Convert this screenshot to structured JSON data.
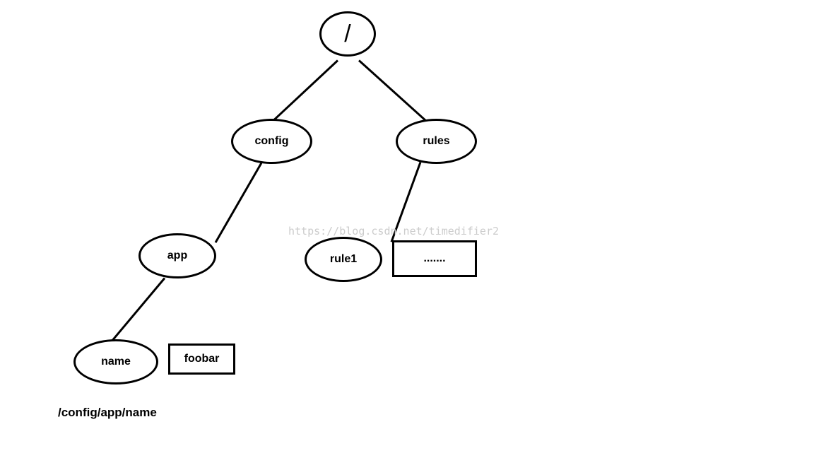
{
  "tree": {
    "root": {
      "label": "/"
    },
    "config": {
      "label": "config"
    },
    "rules": {
      "label": "rules"
    },
    "app": {
      "label": "app"
    },
    "rule1": {
      "label": "rule1"
    },
    "name": {
      "label": "name"
    },
    "foobar_value": {
      "label": "foobar"
    },
    "ellipsis_value": {
      "label": "......."
    }
  },
  "path_label": "/config/app/name",
  "watermark": "https://blog.csdn.net/timedifier2"
}
